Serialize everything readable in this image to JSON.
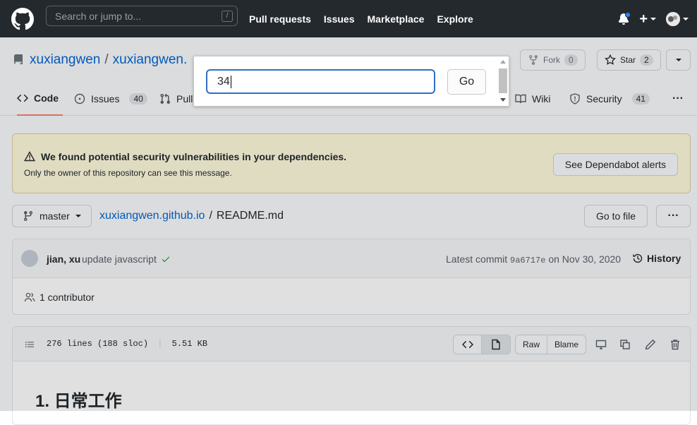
{
  "header": {
    "search_placeholder": "Search or jump to...",
    "search_shortcut": "/",
    "nav": [
      "Pull requests",
      "Issues",
      "Marketplace",
      "Explore"
    ],
    "new_label": "+"
  },
  "repo": {
    "owner": "xuxiangwen",
    "separator": "/",
    "name": "xuxiangwen.",
    "fork_label": "Fork",
    "fork_count": "0",
    "star_label": "Star",
    "star_count": "2"
  },
  "tabs": {
    "code": "Code",
    "issues": "Issues",
    "issues_count": "40",
    "pulls": "Pull",
    "wiki": "Wiki",
    "security": "Security",
    "security_count": "41",
    "more": "···"
  },
  "alert": {
    "title": "We found potential security vulnerabilities in your dependencies.",
    "desc": "Only the owner of this repository can see this message.",
    "button": "See Dependabot alerts"
  },
  "file_nav": {
    "branch": "master",
    "repo_link": "xuxiangwen.github.io",
    "separator": "/",
    "file": "README.md",
    "goto": "Go to file",
    "more": "···"
  },
  "commit": {
    "author": "jian, xu",
    "message": "update javascript",
    "latest_prefix": "Latest commit",
    "sha": "9a6717e",
    "date": "on Nov 30, 2020",
    "history": "History",
    "contributors": "1 contributor"
  },
  "file": {
    "lines": "276 lines (188 sloc)",
    "size": "5.51 KB",
    "raw": "Raw",
    "blame": "Blame",
    "heading": "1. 日常工作"
  },
  "popup": {
    "input_value": "34",
    "go_label": "Go"
  }
}
